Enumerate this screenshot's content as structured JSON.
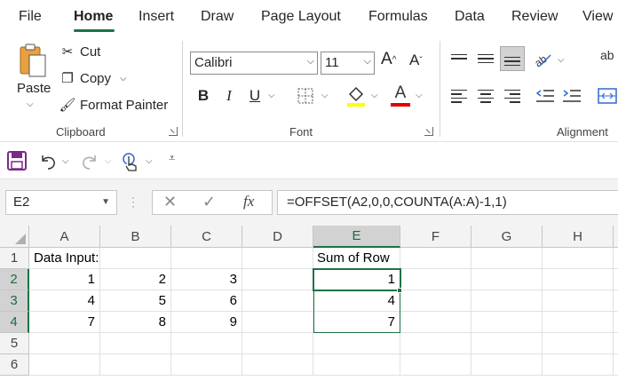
{
  "tabs": [
    {
      "label": "File",
      "active": false
    },
    {
      "label": "Home",
      "active": true
    },
    {
      "label": "Insert",
      "active": false
    },
    {
      "label": "Draw",
      "active": false
    },
    {
      "label": "Page Layout",
      "active": false
    },
    {
      "label": "Formulas",
      "active": false
    },
    {
      "label": "Data",
      "active": false
    },
    {
      "label": "Review",
      "active": false
    },
    {
      "label": "View",
      "active": false
    }
  ],
  "clipboard": {
    "paste_label": "Paste",
    "cut_label": "Cut",
    "copy_label": "Copy",
    "format_painter_label": "Format Painter",
    "group_label": "Clipboard"
  },
  "font": {
    "name": "Calibri",
    "size": "11",
    "bold": "B",
    "italic": "I",
    "underline": "U",
    "grow": "A",
    "shrink": "A",
    "font_color_glyph": "A",
    "group_label": "Font",
    "fill_color": "#ffff00",
    "text_color": "#e00000"
  },
  "alignment": {
    "group_label": "Alignment",
    "wrap_glyph": "ab"
  },
  "formula_bar": {
    "name_box": "E2",
    "fx": "fx",
    "formula": "=OFFSET(A2,0,0,COUNTA(A:A)-1,1)"
  },
  "grid": {
    "columns": [
      "A",
      "B",
      "C",
      "D",
      "E",
      "F",
      "G",
      "H"
    ],
    "rows": [
      "1",
      "2",
      "3",
      "4",
      "5",
      "6"
    ],
    "selected_column": "E",
    "cells": {
      "A1": "Data Input:",
      "A2": "1",
      "B2": "2",
      "C2": "3",
      "A3": "4",
      "B3": "5",
      "C3": "6",
      "A4": "7",
      "B4": "8",
      "C4": "9",
      "E1": "Sum of Row",
      "E2": "1",
      "E3": "4",
      "E4": "7"
    }
  },
  "colors": {
    "accent": "#1e7145",
    "save_icon": "#7a2a8a"
  }
}
